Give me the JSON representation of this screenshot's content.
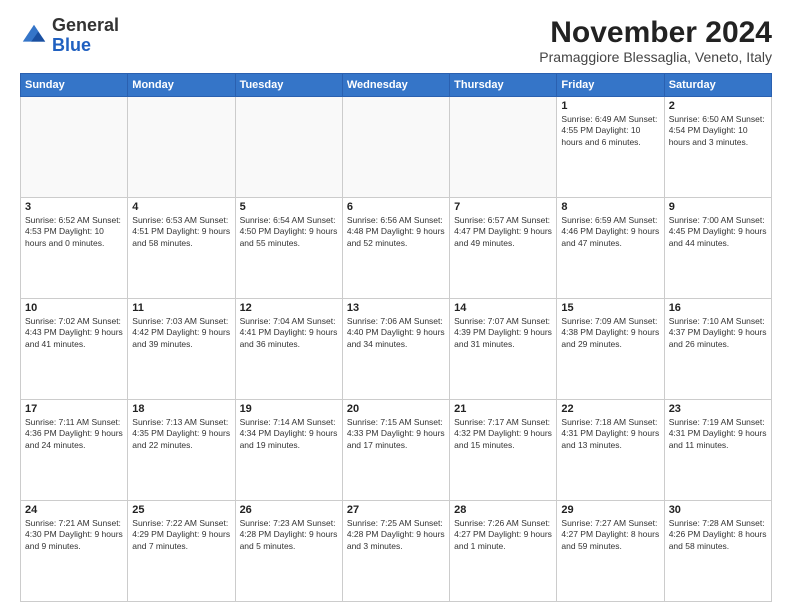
{
  "header": {
    "logo_general": "General",
    "logo_blue": "Blue",
    "month_title": "November 2024",
    "subtitle": "Pramaggiore Blessaglia, Veneto, Italy"
  },
  "weekdays": [
    "Sunday",
    "Monday",
    "Tuesday",
    "Wednesday",
    "Thursday",
    "Friday",
    "Saturday"
  ],
  "weeks": [
    [
      {
        "day": "",
        "info": ""
      },
      {
        "day": "",
        "info": ""
      },
      {
        "day": "",
        "info": ""
      },
      {
        "day": "",
        "info": ""
      },
      {
        "day": "",
        "info": ""
      },
      {
        "day": "1",
        "info": "Sunrise: 6:49 AM\nSunset: 4:55 PM\nDaylight: 10 hours\nand 6 minutes."
      },
      {
        "day": "2",
        "info": "Sunrise: 6:50 AM\nSunset: 4:54 PM\nDaylight: 10 hours\nand 3 minutes."
      }
    ],
    [
      {
        "day": "3",
        "info": "Sunrise: 6:52 AM\nSunset: 4:53 PM\nDaylight: 10 hours\nand 0 minutes."
      },
      {
        "day": "4",
        "info": "Sunrise: 6:53 AM\nSunset: 4:51 PM\nDaylight: 9 hours\nand 58 minutes."
      },
      {
        "day": "5",
        "info": "Sunrise: 6:54 AM\nSunset: 4:50 PM\nDaylight: 9 hours\nand 55 minutes."
      },
      {
        "day": "6",
        "info": "Sunrise: 6:56 AM\nSunset: 4:48 PM\nDaylight: 9 hours\nand 52 minutes."
      },
      {
        "day": "7",
        "info": "Sunrise: 6:57 AM\nSunset: 4:47 PM\nDaylight: 9 hours\nand 49 minutes."
      },
      {
        "day": "8",
        "info": "Sunrise: 6:59 AM\nSunset: 4:46 PM\nDaylight: 9 hours\nand 47 minutes."
      },
      {
        "day": "9",
        "info": "Sunrise: 7:00 AM\nSunset: 4:45 PM\nDaylight: 9 hours\nand 44 minutes."
      }
    ],
    [
      {
        "day": "10",
        "info": "Sunrise: 7:02 AM\nSunset: 4:43 PM\nDaylight: 9 hours\nand 41 minutes."
      },
      {
        "day": "11",
        "info": "Sunrise: 7:03 AM\nSunset: 4:42 PM\nDaylight: 9 hours\nand 39 minutes."
      },
      {
        "day": "12",
        "info": "Sunrise: 7:04 AM\nSunset: 4:41 PM\nDaylight: 9 hours\nand 36 minutes."
      },
      {
        "day": "13",
        "info": "Sunrise: 7:06 AM\nSunset: 4:40 PM\nDaylight: 9 hours\nand 34 minutes."
      },
      {
        "day": "14",
        "info": "Sunrise: 7:07 AM\nSunset: 4:39 PM\nDaylight: 9 hours\nand 31 minutes."
      },
      {
        "day": "15",
        "info": "Sunrise: 7:09 AM\nSunset: 4:38 PM\nDaylight: 9 hours\nand 29 minutes."
      },
      {
        "day": "16",
        "info": "Sunrise: 7:10 AM\nSunset: 4:37 PM\nDaylight: 9 hours\nand 26 minutes."
      }
    ],
    [
      {
        "day": "17",
        "info": "Sunrise: 7:11 AM\nSunset: 4:36 PM\nDaylight: 9 hours\nand 24 minutes."
      },
      {
        "day": "18",
        "info": "Sunrise: 7:13 AM\nSunset: 4:35 PM\nDaylight: 9 hours\nand 22 minutes."
      },
      {
        "day": "19",
        "info": "Sunrise: 7:14 AM\nSunset: 4:34 PM\nDaylight: 9 hours\nand 19 minutes."
      },
      {
        "day": "20",
        "info": "Sunrise: 7:15 AM\nSunset: 4:33 PM\nDaylight: 9 hours\nand 17 minutes."
      },
      {
        "day": "21",
        "info": "Sunrise: 7:17 AM\nSunset: 4:32 PM\nDaylight: 9 hours\nand 15 minutes."
      },
      {
        "day": "22",
        "info": "Sunrise: 7:18 AM\nSunset: 4:31 PM\nDaylight: 9 hours\nand 13 minutes."
      },
      {
        "day": "23",
        "info": "Sunrise: 7:19 AM\nSunset: 4:31 PM\nDaylight: 9 hours\nand 11 minutes."
      }
    ],
    [
      {
        "day": "24",
        "info": "Sunrise: 7:21 AM\nSunset: 4:30 PM\nDaylight: 9 hours\nand 9 minutes."
      },
      {
        "day": "25",
        "info": "Sunrise: 7:22 AM\nSunset: 4:29 PM\nDaylight: 9 hours\nand 7 minutes."
      },
      {
        "day": "26",
        "info": "Sunrise: 7:23 AM\nSunset: 4:28 PM\nDaylight: 9 hours\nand 5 minutes."
      },
      {
        "day": "27",
        "info": "Sunrise: 7:25 AM\nSunset: 4:28 PM\nDaylight: 9 hours\nand 3 minutes."
      },
      {
        "day": "28",
        "info": "Sunrise: 7:26 AM\nSunset: 4:27 PM\nDaylight: 9 hours\nand 1 minute."
      },
      {
        "day": "29",
        "info": "Sunrise: 7:27 AM\nSunset: 4:27 PM\nDaylight: 8 hours\nand 59 minutes."
      },
      {
        "day": "30",
        "info": "Sunrise: 7:28 AM\nSunset: 4:26 PM\nDaylight: 8 hours\nand 58 minutes."
      }
    ]
  ]
}
